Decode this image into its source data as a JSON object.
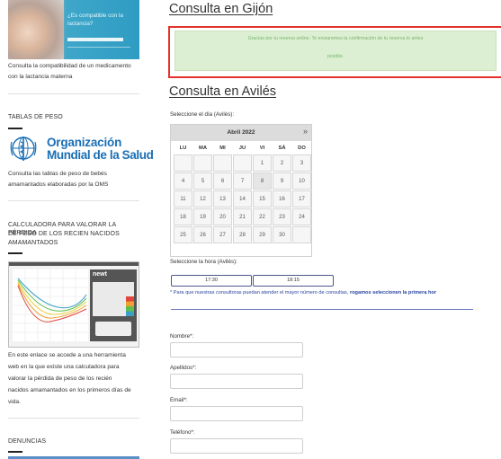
{
  "sidebar": {
    "promo_image": {
      "line1": "¿Es compatible con la",
      "line2": "lactancia?"
    },
    "lactancia_text_1": "Consulta la compatibilidad de un medicamento",
    "lactancia_text_2": "con la lactancia materna",
    "tablas_heading": "TABLAS DE PESO",
    "oms_logo": {
      "line1": "Organización",
      "line2": "Mundial de la Salud"
    },
    "tablas_text_1": "Consulta las tablas de peso de bebés",
    "tablas_text_2": "amamantados elaboradas por la OMS",
    "calc_heading_1": "CALCULADORA PARA VALORAR LA PÉRDIDA",
    "calc_heading_2": "DE PESO DE LOS RECIEN NACIDOS",
    "calc_heading_3": "AMAMANTADOS",
    "chart_thumbnail": {
      "app_title": "newt"
    },
    "calc_text_1": "En este enlace se accede a una herramienta",
    "calc_text_2": "web en la que existe una calculadora para",
    "calc_text_3": "valorar la pérdida de peso de los recién",
    "calc_text_4": "nacidos amamantados en los primeros días de",
    "calc_text_5": "vida.",
    "denuncias_heading": "DENUNCIAS"
  },
  "main": {
    "gijon_title": "Consulta en Gijón",
    "confirmation_line1": "Gracias por tu reserva online. Te enviaremos la confirmación de tu reserva lo antes",
    "confirmation_line2": "posible.",
    "aviles_title": "Consulta en Avilés",
    "select_day_label": "Seleccione el día (Avilés):",
    "calendar": {
      "month_label": "Abril 2022",
      "next_icon": "»",
      "weekdays": [
        "LU",
        "MA",
        "MI",
        "JU",
        "VI",
        "SÁ",
        "DO"
      ],
      "weeks": [
        [
          "",
          "",
          "",
          "",
          "1",
          "2",
          "3"
        ],
        [
          "4",
          "5",
          "6",
          "7",
          "8",
          "9",
          "10"
        ],
        [
          "11",
          "12",
          "13",
          "14",
          "15",
          "16",
          "17"
        ],
        [
          "18",
          "19",
          "20",
          "21",
          "22",
          "23",
          "24"
        ],
        [
          "25",
          "26",
          "27",
          "28",
          "29",
          "30",
          ""
        ]
      ]
    },
    "select_time_label": "Seleccione la hora (Avilés):",
    "time_slots": [
      "17:30",
      "18:15"
    ],
    "note_prefix": "* Para que nuestras consultoras puedan atender el mayor número de consultas, ",
    "note_bold": "rogamos seleccionen la primera hor",
    "form": {
      "nombre_label": "Nombre*:",
      "apellidos_label": "Apellidos*:",
      "email_label": "Email*:",
      "telefono_label": "Teléfono*:"
    }
  },
  "colors": {
    "alert_border": "#e4322b",
    "alert_bg": "#dcefd2",
    "alert_text": "#7ab56f",
    "note_blue": "#2b47a0",
    "oms_blue": "#1a6fb5"
  }
}
